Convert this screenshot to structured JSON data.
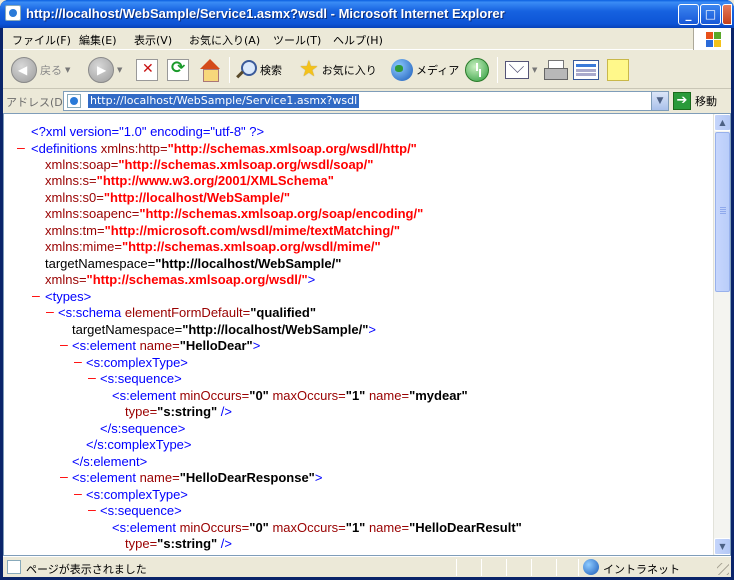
{
  "window": {
    "title": "http://localhost/WebSample/Service1.asmx?wsdl - Microsoft Internet Explorer",
    "minimize": "_",
    "maximize": "□",
    "close": "✕"
  },
  "menu": [
    "ファイル(F)",
    "編集(E)",
    "表示(V)",
    "お気に入り(A)",
    "ツール(T)",
    "ヘルプ(H)"
  ],
  "toolbar": {
    "back_label": "戻る",
    "search_label": "検索",
    "favorites_label": "お気に入り",
    "media_label": "メディア"
  },
  "address": {
    "label": "アドレス(D)",
    "url": "http://localhost/WebSample/Service1.asmx?wsdl",
    "go_label": "移動"
  },
  "xml_lines": {
    "decl": "<?xml version=\"1.0\" encoding=\"utf-8\" ?>",
    "l1_a": "<definitions",
    "l1_b": " xmlns:http=",
    "l1_c": "\"http://schemas.xmlsoap.org/wsdl/http/\"",
    "l2_a": "xmlns:soap=",
    "l2_b": "\"http://schemas.xmlsoap.org/wsdl/soap/\"",
    "l3_a": "xmlns:s=",
    "l3_b": "\"http://www.w3.org/2001/XMLSchema\"",
    "l4_a": "xmlns:s0=",
    "l4_b": "\"http://localhost/WebSample/\"",
    "l5_a": "xmlns:soapenc=",
    "l5_b": "\"http://schemas.xmlsoap.org/soap/encoding/\"",
    "l6_a": "xmlns:tm=",
    "l6_b": "\"http://microsoft.com/wsdl/mime/textMatching/\"",
    "l7_a": "xmlns:mime=",
    "l7_b": "\"http://schemas.xmlsoap.org/wsdl/mime/\"",
    "l8_a": "targetNamespace=",
    "l8_b": "\"http://localhost/WebSample/\"",
    "l9_a": "xmlns=",
    "l9_b": "\"http://schemas.xmlsoap.org/wsdl/\"",
    "l9_c": ">",
    "types": "<types>",
    "schema_a": "<s:schema",
    "schema_b": " elementFormDefault=",
    "schema_c": "\"qualified\"",
    "schema2_a": "targetNamespace=",
    "schema2_b": "\"http://localhost/WebSample/\"",
    "schema2_c": ">",
    "el1_a": "<s:element",
    "el1_b": " name=",
    "el1_c": "\"HelloDear\"",
    "el1_d": ">",
    "ct1": "<s:complexType>",
    "seq1": "<s:sequence>",
    "el2_a": "<s:element",
    "el2_b": " minOccurs=",
    "el2_c": "\"0\"",
    "el2_d": " maxOccurs=",
    "el2_e": "\"1\"",
    "el2_f": " name=",
    "el2_g": "\"mydear\"",
    "type1_a": "type=",
    "type1_b": "\"s:string\"",
    "type1_c": " />",
    "seq1_end": "</s:sequence>",
    "ct1_end": "</s:complexType>",
    "el1_end": "</s:element>",
    "el3_a": "<s:element",
    "el3_b": " name=",
    "el3_c": "\"HelloDearResponse\"",
    "el3_d": ">",
    "ct2": "<s:complexType>",
    "seq2": "<s:sequence>",
    "el4_a": "<s:element",
    "el4_b": " minOccurs=",
    "el4_c": "\"0\"",
    "el4_d": " maxOccurs=",
    "el4_e": "\"1\"",
    "el4_f": " name=",
    "el4_g": "\"HelloDearResult\"",
    "type2_a": "type=",
    "type2_b": "\"s:string\"",
    "type2_c": " />",
    "minus": "–"
  },
  "status": {
    "text": "ページが表示されました",
    "zone": "イントラネット"
  },
  "colors": {
    "titlebar": "#0d54d6",
    "markup_blue": "#0000ff",
    "attr_red": "#990000",
    "value_red": "#ff0000"
  },
  "icons": [
    "back-icon",
    "forward-icon",
    "stop-icon",
    "refresh-icon",
    "home-icon",
    "search-icon",
    "favorites-icon",
    "media-icon",
    "history-icon",
    "mail-icon",
    "print-icon",
    "edit-icon",
    "discuss-icon",
    "page-icon",
    "go-icon",
    "zone-icon"
  ]
}
